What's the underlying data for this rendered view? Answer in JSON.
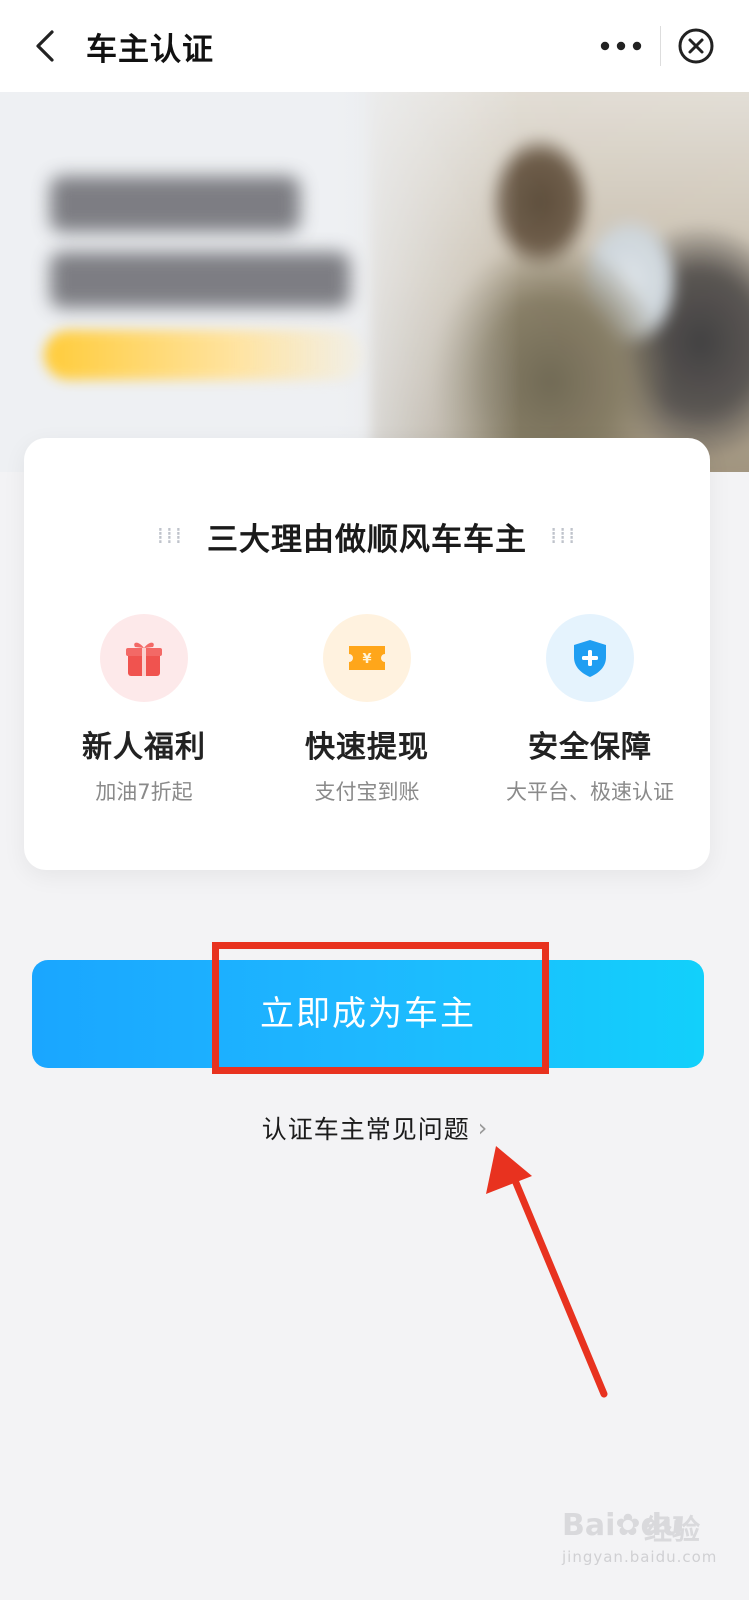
{
  "nav": {
    "title": "车主认证"
  },
  "card": {
    "heading": "三大理由做顺风车车主",
    "features": [
      {
        "icon": "gift-icon",
        "name": "新人福利",
        "sub": "加油7折起",
        "color": "#f0534f"
      },
      {
        "icon": "ticket-icon",
        "name": "快速提现",
        "sub": "支付宝到账",
        "color": "#ffa61a"
      },
      {
        "icon": "shield-plus-icon",
        "name": "安全保障",
        "sub": "大平台、极速认证",
        "color": "#1f9ef2"
      }
    ]
  },
  "cta": {
    "label": "立即成为车主",
    "gradient_start": "#1aa6ff",
    "gradient_end": "#12d0fb"
  },
  "faq": {
    "label": "认证车主常见问题"
  },
  "annotation": {
    "color": "#e8321f"
  },
  "watermark": {
    "brand": "Bai",
    "brand2": "du",
    "cn": "经验",
    "url": "jingyan.baidu.com"
  }
}
